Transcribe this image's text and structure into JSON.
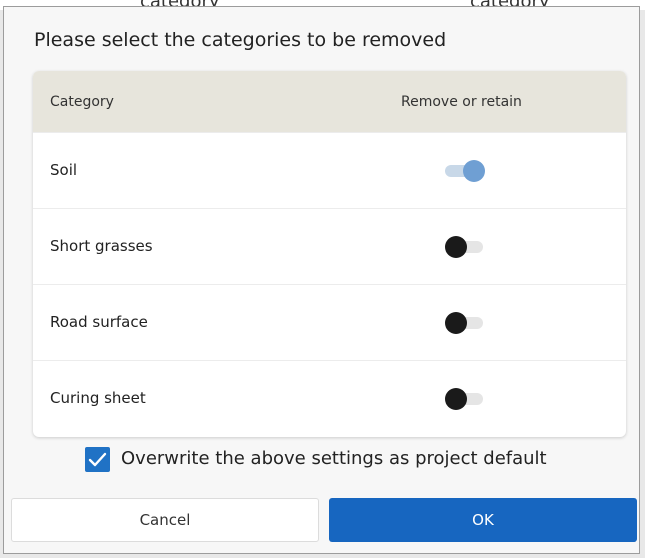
{
  "dialog": {
    "title": "Please select the categories to be removed",
    "table": {
      "columns": [
        "Category",
        "Remove or retain"
      ],
      "rows": [
        {
          "category": "Soil",
          "remove": true
        },
        {
          "category": "Short grasses",
          "remove": false
        },
        {
          "category": "Road surface",
          "remove": false
        },
        {
          "category": "Curing sheet",
          "remove": false
        }
      ]
    },
    "default_checkbox": {
      "label": "Overwrite the above settings as project default",
      "checked": true
    },
    "buttons": {
      "cancel_label": "Cancel",
      "ok_label": "OK"
    }
  },
  "colors": {
    "primary": "#1766c0",
    "checkbox": "#2072c5",
    "toggle_on": "#6f9fd3",
    "toggle_off_knob": "#1a1a1a",
    "header_bg": "#e7e5dc"
  }
}
